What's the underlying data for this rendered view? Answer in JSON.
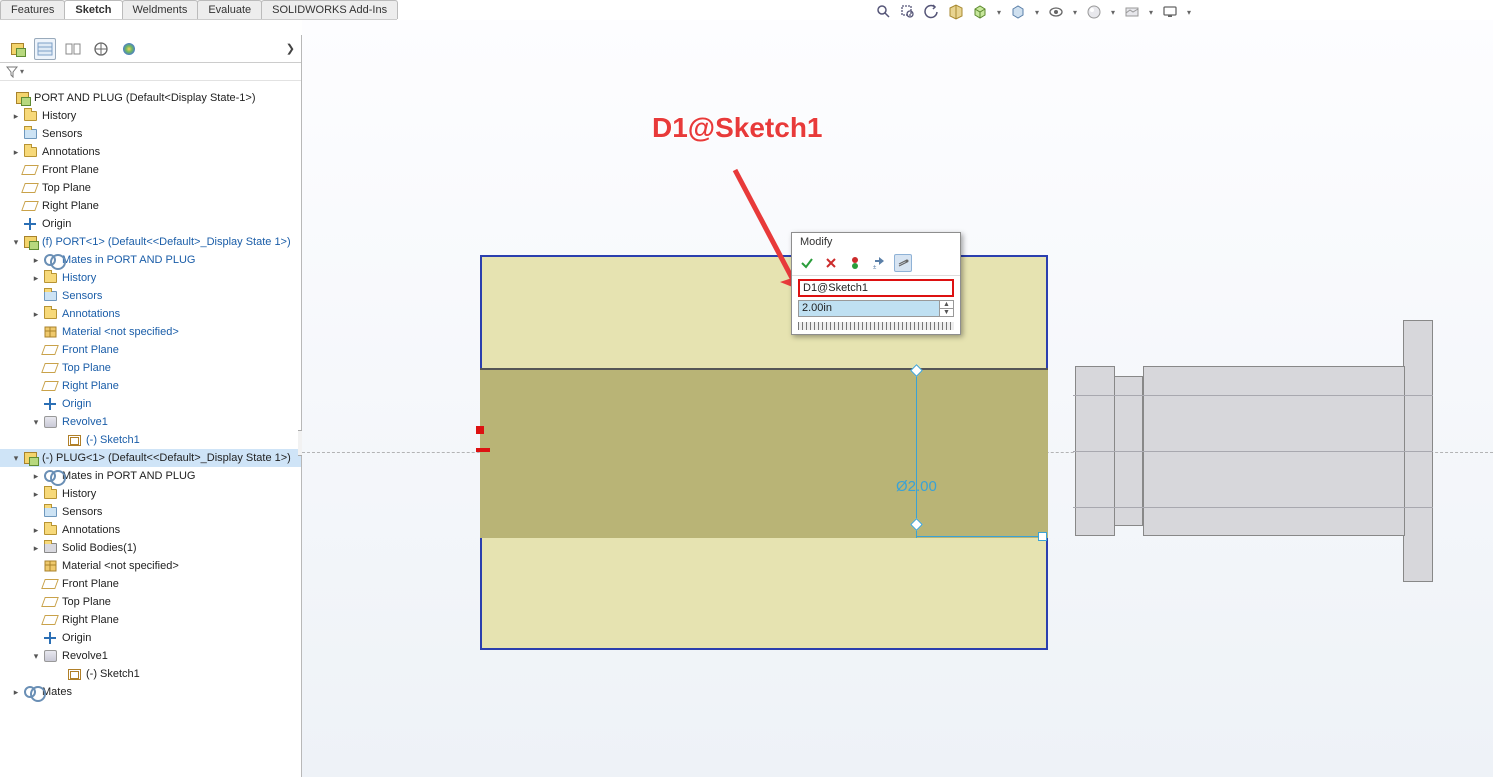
{
  "tabs": {
    "items": [
      "Features",
      "Sketch",
      "Weldments",
      "Evaluate",
      "SOLIDWORKS Add-Ins"
    ],
    "active": 1
  },
  "panel_buttons": [
    "assembly",
    "list",
    "config",
    "target",
    "appearance"
  ],
  "tree": {
    "root": "PORT AND PLUG  (Default<Display State-1>)",
    "port_component": "(f) PORT<1> (Default<<Default>_Display State 1>)",
    "plug_component": "(-) PLUG<1> (Default<<Default>_Display State 1>)",
    "history": "History",
    "sensors": "Sensors",
    "annotations": "Annotations",
    "front": "Front Plane",
    "top": "Top Plane",
    "right": "Right Plane",
    "origin": "Origin",
    "mates_in": "Mates in PORT AND PLUG",
    "material": "Material <not specified>",
    "solid_bodies": "Solid Bodies(1)",
    "revolve": "Revolve1",
    "sketch": "(-) Sketch1",
    "mates": "Mates"
  },
  "callout": "D1@Sketch1",
  "modify": {
    "title": "Modify",
    "name": "D1@Sketch1",
    "value": "2.00in"
  },
  "dimension": "Ø2.00",
  "hud_icons": [
    "zoom-fit",
    "zoom-area",
    "zoom-prev",
    "section",
    "view-orient",
    "display-style",
    "scene",
    "hide-show",
    "edit-appearance",
    "apply-scene",
    "view-settings"
  ]
}
